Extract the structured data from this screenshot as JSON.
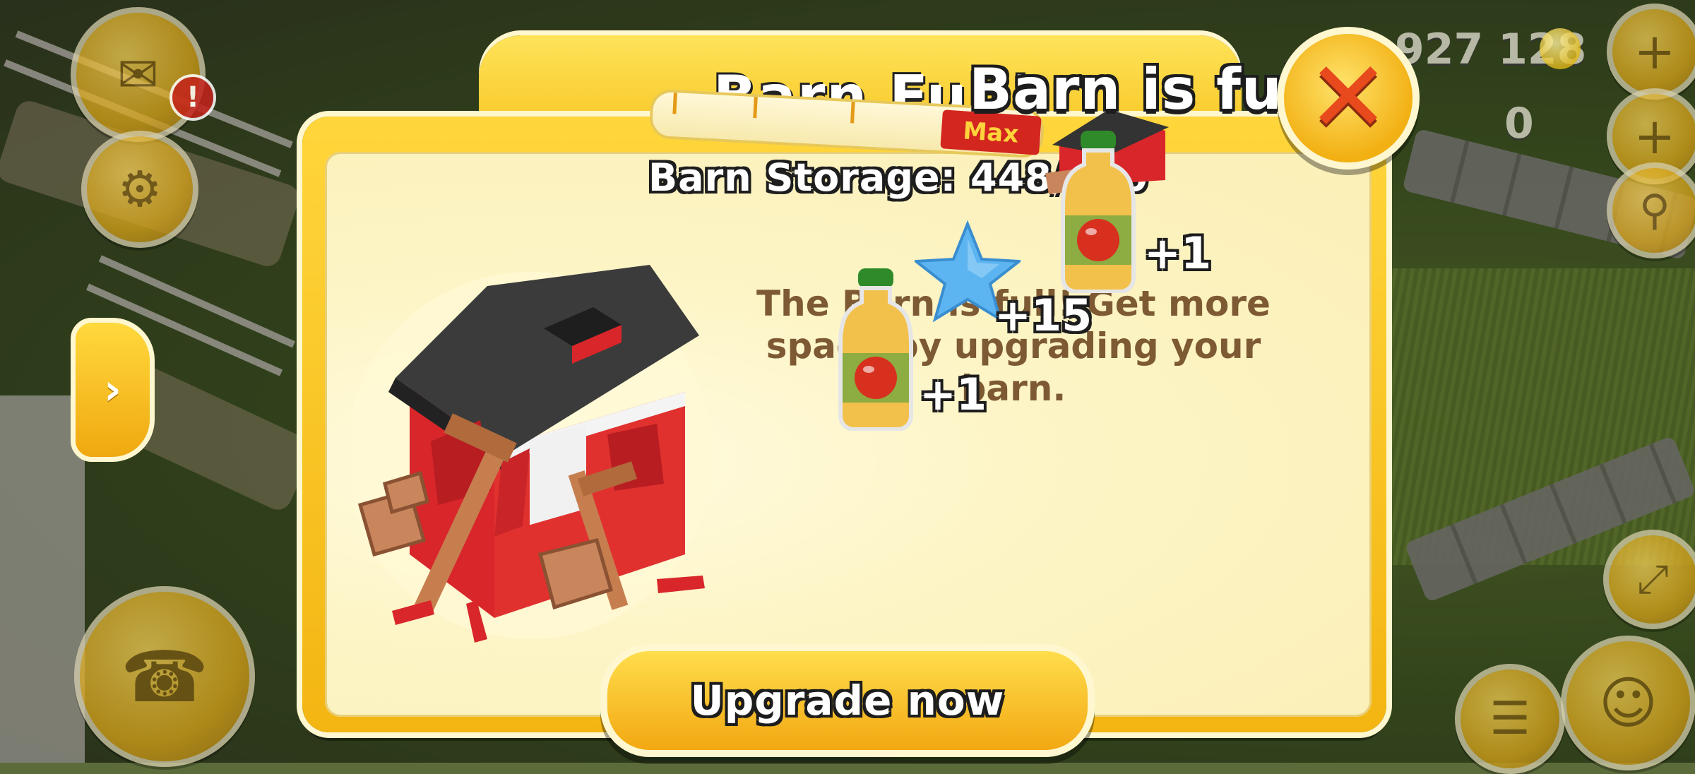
{
  "hud": {
    "coins": "927 128",
    "diamonds": "0",
    "alert_badge": "!"
  },
  "dialog": {
    "title": "Barn is full!",
    "title_behind": "Barn Full!",
    "max_label": "Max",
    "storage_label": "Barn Storage: 448/450",
    "storage_fraction": 0.9956,
    "message": "The Barn is full! Get more space by upgrading your barn.",
    "upgrade_button": "Upgrade now",
    "close_icon": "close-x-icon"
  },
  "rewards": {
    "xp": "+15",
    "juice_top": "+1",
    "juice_left": "+1"
  },
  "colors": {
    "dialog_yellow": "#f6c21c",
    "panel_cream": "#fdf5c7",
    "close_red": "#e8491d",
    "message_brown": "#7d5a34"
  }
}
